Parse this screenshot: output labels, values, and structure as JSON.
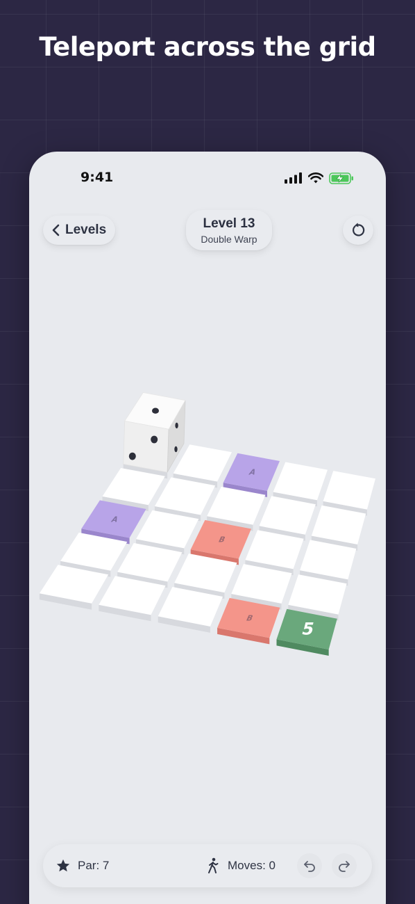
{
  "headline": "Teleport across the grid",
  "status_bar": {
    "time": "9:41"
  },
  "header": {
    "back_label": "Levels",
    "level_title": "Level 13",
    "level_subtitle": "Double Warp"
  },
  "board": {
    "rows": [
      [
        "empty",
        "empty",
        "portal-A",
        "empty",
        "empty"
      ],
      [
        "empty",
        "empty",
        "empty",
        "empty",
        "empty"
      ],
      [
        "portal-A",
        "empty",
        "portal-B",
        "empty",
        "empty"
      ],
      [
        "empty",
        "empty",
        "empty",
        "empty",
        "empty"
      ],
      [
        "empty",
        "empty",
        "empty",
        "portal-B",
        "goal"
      ]
    ],
    "goal_label": "5",
    "portal_a_label": "A",
    "portal_b_label": "B",
    "die_position": {
      "row": 0,
      "col": 0
    },
    "colors": {
      "tile": "#ffffff",
      "portal_a": "#b8a4e8",
      "portal_b": "#f4958a",
      "goal": "#6aa87c",
      "pip": "#2d2f3a"
    }
  },
  "footer": {
    "par_label": "Par: 7",
    "moves_label": "Moves: 0"
  },
  "icons": {
    "back": "chevron-left-icon",
    "restart": "restart-icon",
    "par": "star-icon",
    "moves": "walking-icon",
    "undo": "undo-icon",
    "redo": "redo-icon"
  }
}
